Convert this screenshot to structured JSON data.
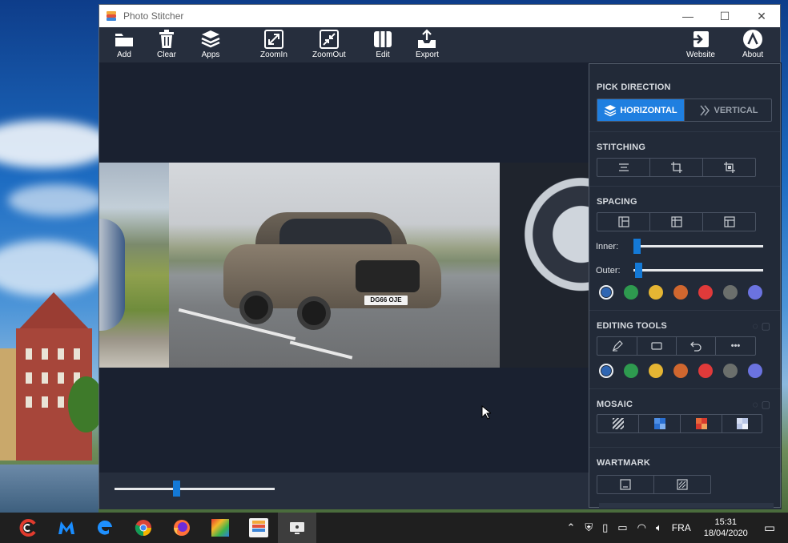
{
  "window": {
    "title": "Photo Stitcher",
    "controls": {
      "minimize": "—",
      "maximize": "☐",
      "close": "✕"
    }
  },
  "toolbar": {
    "add": "Add",
    "clear": "Clear",
    "apps": "Apps",
    "zoomin": "ZoomIn",
    "zoomout": "ZoomOut",
    "edit": "Edit",
    "export": "Export",
    "website": "Website",
    "about": "About"
  },
  "canvas": {
    "plate_text": "DG66 OJE"
  },
  "zoom_slider": {
    "value_fraction": 0.38
  },
  "panel": {
    "pick_direction": {
      "title": "PICK DIRECTION",
      "horizontal": "HORIZONTAL",
      "vertical": "VERTICAL",
      "selected": "horizontal"
    },
    "stitching": {
      "title": "STITCHING"
    },
    "spacing": {
      "title": "SPACING",
      "inner_label": "Inner:",
      "outer_label": "Outer:",
      "inner_value": 0.0,
      "outer_value": 0.01
    },
    "spacing_colors": [
      "#2f66b3",
      "#2e9a4f",
      "#e5b533",
      "#d0672f",
      "#e03a3a",
      "#6b6f6c",
      "#6b73e0"
    ],
    "editing_tools": {
      "title": "EDITING TOOLS",
      "more_label": "•••"
    },
    "editing_colors": [
      "#2f66b3",
      "#2e9a4f",
      "#e5b533",
      "#d0672f",
      "#e03a3a",
      "#6b6f6c",
      "#6b73e0"
    ],
    "mosaic": {
      "title": "MOSAIC"
    },
    "watermark": {
      "title": "WARTMARK"
    }
  },
  "taskbar": {
    "language": "FRA",
    "time": "15:31",
    "date": "18/04/2020",
    "apps": [
      "ccleaner-icon",
      "malwarebytes-icon",
      "edge-icon",
      "chrome-icon",
      "firefox-icon",
      "colorful-app-icon",
      "photo-stitcher-icon",
      "screen-app-icon"
    ]
  },
  "colors": {
    "accent": "#1f7fe0",
    "panel_bg": "#222a38",
    "toolbar_bg": "#262e3d"
  }
}
